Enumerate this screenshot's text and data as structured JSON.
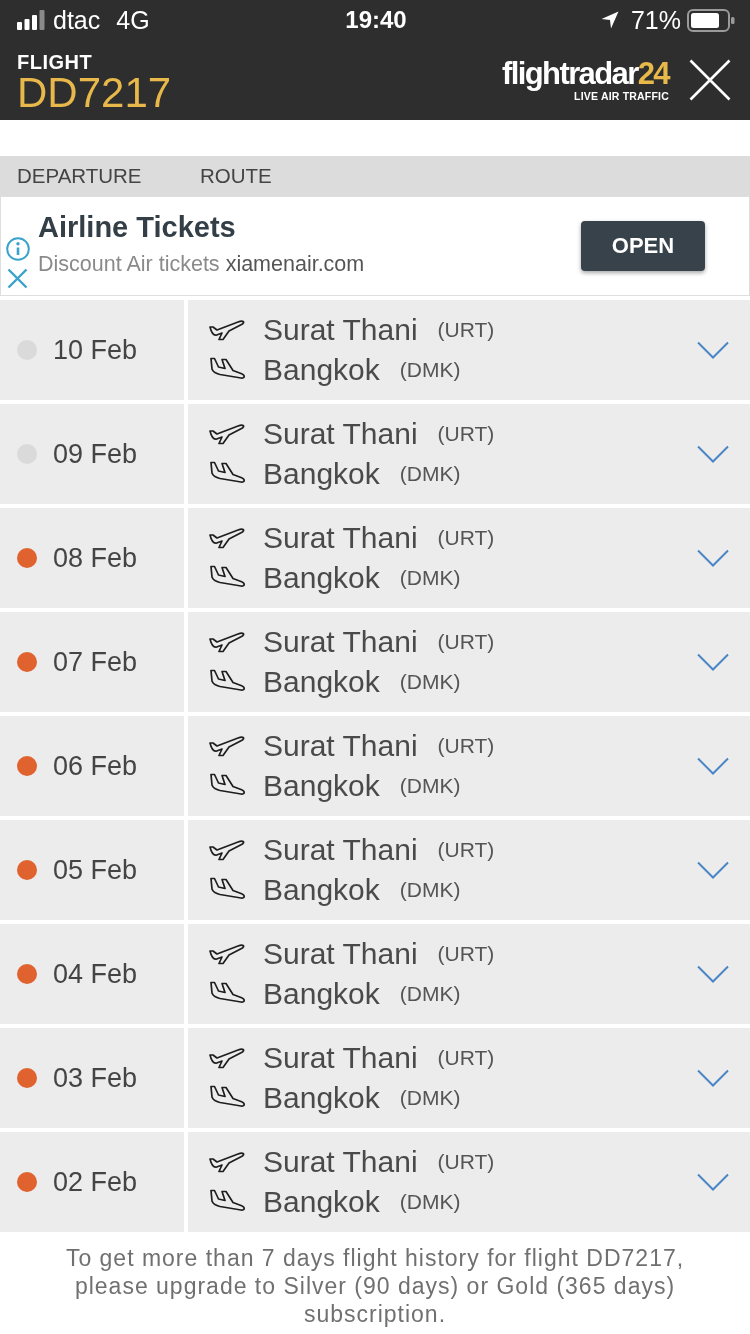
{
  "status_bar": {
    "carrier": "dtac",
    "network": "4G",
    "time": "19:40",
    "battery": "71%"
  },
  "header": {
    "label": "FLIGHT",
    "flight_number": "DD7217",
    "logo": {
      "wordmark": "flightradar",
      "wordmark_number": "24",
      "tagline": "LIVE AIR TRAFFIC"
    }
  },
  "table": {
    "columns": [
      "DEPARTURE",
      "ROUTE"
    ]
  },
  "ad": {
    "title": "Airline Tickets",
    "description": "Discount Air tickets",
    "domain": "xiamenair.com",
    "button": "OPEN"
  },
  "flights": [
    {
      "date": "10 Feb",
      "color": "#dadada",
      "origin": "Surat Thani",
      "origin_code": "(URT)",
      "destination": "Bangkok",
      "destination_code": "(DMK)",
      "expanded": false
    },
    {
      "date": "09 Feb",
      "color": "#dadada",
      "origin": "Surat Thani",
      "origin_code": "(URT)",
      "destination": "Bangkok",
      "destination_code": "(DMK)",
      "expanded": false
    },
    {
      "date": "08 Feb",
      "color": "#e0622e",
      "origin": "Surat Thani",
      "origin_code": "(URT)",
      "destination": "Bangkok",
      "destination_code": "(DMK)",
      "expanded": false
    },
    {
      "date": "07 Feb",
      "color": "#e0622e",
      "origin": "Surat Thani",
      "origin_code": "(URT)",
      "destination": "Bangkok",
      "destination_code": "(DMK)",
      "expanded": false
    },
    {
      "date": "06 Feb",
      "color": "#e0622e",
      "origin": "Surat Thani",
      "origin_code": "(URT)",
      "destination": "Bangkok",
      "destination_code": "(DMK)",
      "expanded": false
    },
    {
      "date": "05 Feb",
      "color": "#e0622e",
      "origin": "Surat Thani",
      "origin_code": "(URT)",
      "destination": "Bangkok",
      "destination_code": "(DMK)",
      "expanded": false
    },
    {
      "date": "04 Feb",
      "color": "#e0622e",
      "origin": "Surat Thani",
      "origin_code": "(URT)",
      "destination": "Bangkok",
      "destination_code": "(DMK)",
      "expanded": false
    },
    {
      "date": "03 Feb",
      "color": "#e0622e",
      "origin": "Surat Thani",
      "origin_code": "(URT)",
      "destination": "Bangkok",
      "destination_code": "(DMK)",
      "expanded": false
    },
    {
      "date": "02 Feb",
      "color": "#e0622e",
      "origin": "Surat Thani",
      "origin_code": "(URT)",
      "destination": "Bangkok",
      "destination_code": "(DMK)",
      "expanded": false
    }
  ],
  "footer_note": "To get more than 7 days flight history for flight DD7217, please upgrade to Silver (90 days) or Gold (365 days) subscription."
}
